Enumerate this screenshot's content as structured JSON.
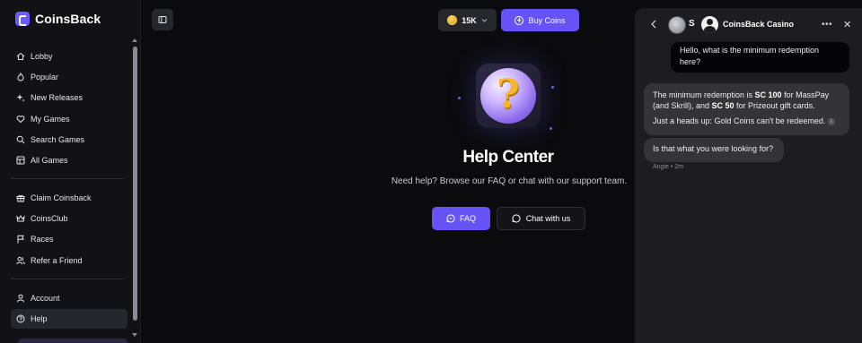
{
  "app": {
    "name": "CoinsBack",
    "brand_color": "#6653f5"
  },
  "sidebar": {
    "primary": [
      {
        "label": "Lobby",
        "icon": "home-icon"
      },
      {
        "label": "Popular",
        "icon": "flame-icon"
      },
      {
        "label": "New Releases",
        "icon": "sparkles-icon"
      },
      {
        "label": "My Games",
        "icon": "heart-icon"
      },
      {
        "label": "Search Games",
        "icon": "search-icon"
      },
      {
        "label": "All Games",
        "icon": "grid-icon"
      }
    ],
    "secondary": [
      {
        "label": "Claim Coinsback",
        "icon": "gift-icon"
      },
      {
        "label": "CoinsClub",
        "icon": "crown-icon"
      },
      {
        "label": "Races",
        "icon": "flag-icon"
      },
      {
        "label": "Refer a Friend",
        "icon": "users-icon"
      }
    ],
    "account": [
      {
        "label": "Account",
        "icon": "user-icon"
      },
      {
        "label": "Help",
        "icon": "help-circle-icon",
        "active": true
      }
    ]
  },
  "topbar": {
    "coins_balance": "15K",
    "buy_label": "Buy Coins"
  },
  "help": {
    "title": "Help Center",
    "subtitle": "Need help? Browse our FAQ or chat with our support team.",
    "faq_label": "FAQ",
    "chat_label": "Chat with us"
  },
  "chat": {
    "avatar_letter": "S",
    "title": "CoinsBack Casino",
    "more": "•••",
    "close": "✕",
    "user_message": "Hello, what is the minimum redemption here?",
    "agent_message_1": {
      "part1": "The minimum redemption is ",
      "sc100": "SC 100",
      "part2": " for MassPay (and Skrill), and ",
      "sc50": "SC 50",
      "part3": " for Prizeout gift cards.",
      "line2": "Just a heads up: Gold Coins can't be redeemed.",
      "info": "i"
    },
    "agent_message_2": "Is that what you were looking for?",
    "meta": "Angie • 2m"
  }
}
